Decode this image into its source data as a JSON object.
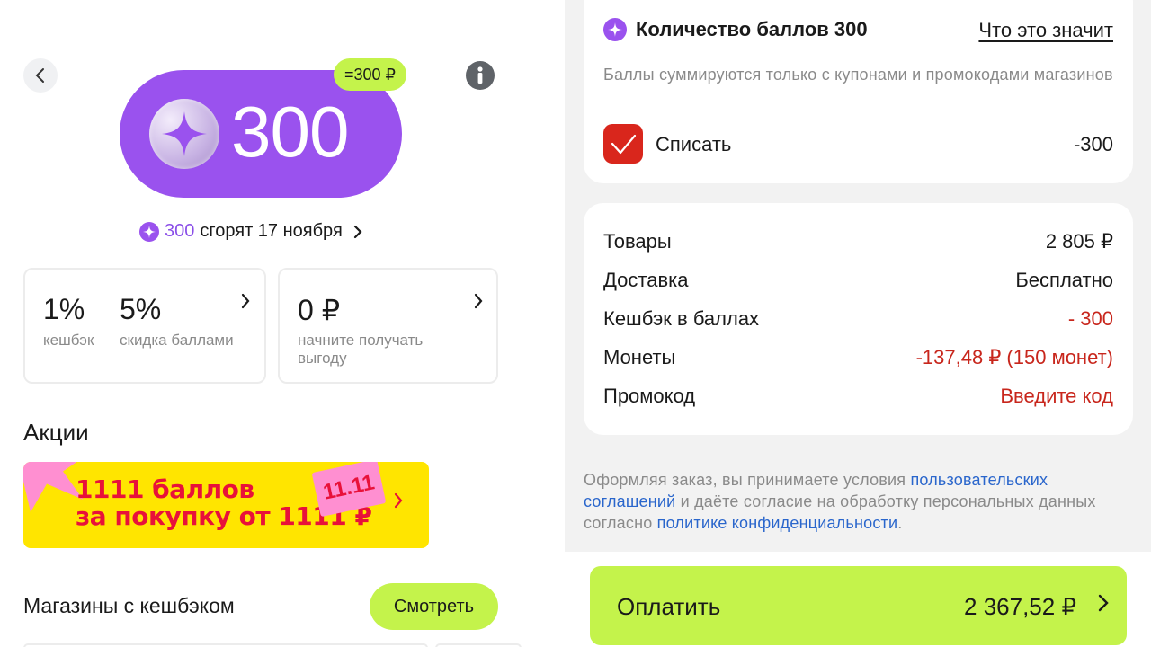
{
  "left": {
    "balance": "300",
    "rub_badge": "=300 ₽",
    "expire": {
      "amount": "300",
      "text": "сгорят 17 ноября"
    },
    "card1": {
      "cashback_value": "1%",
      "cashback_label": "кешбэк",
      "discount_value": "5%",
      "discount_label": "скидка баллами"
    },
    "card2": {
      "value": "0 ₽",
      "label_line1": "начните получать",
      "label_line2": "выгоду"
    },
    "promotions_title": "Акции",
    "promo": {
      "line1": "1111 баллов",
      "line2": "за покупку от 1111 ₽",
      "tag": "11.11"
    },
    "shops_title": "Магазины с кешбэком",
    "see_button": "Смотреть"
  },
  "right": {
    "points": {
      "title": "Количество баллов 300",
      "link": "Что это значит",
      "description": "Баллы суммируются только с купонами и промокодами магазинов",
      "writeoff_label": "Списать",
      "writeoff_value": "-300",
      "checked": true
    },
    "summary": [
      {
        "label": "Товары",
        "value": "2 805 ₽",
        "highlight": false
      },
      {
        "label": "Доставка",
        "value": "Бесплатно",
        "highlight": false
      },
      {
        "label": "Кешбэк в баллах",
        "value": "- 300",
        "highlight": true
      },
      {
        "label": "Монеты",
        "value": "-137,48 ₽ (150 монет)",
        "highlight": true
      },
      {
        "label": "Промокод",
        "value": "Введите код",
        "highlight": true
      }
    ],
    "terms": {
      "part1": "Оформляя заказ, вы принимаете условия ",
      "link1": "пользовательских соглашений",
      "part2": " и даёте согласие на обработку персональных данных согласно ",
      "link2": "политике конфиденциальности",
      "part3": "."
    },
    "pay": {
      "label": "Оплатить",
      "amount": "2 367,52 ₽"
    }
  },
  "colors": {
    "accent_purple": "#9a52ee",
    "accent_lime": "#c4f34b",
    "alert_red": "#c8261c",
    "link_blue": "#2a66cc"
  }
}
